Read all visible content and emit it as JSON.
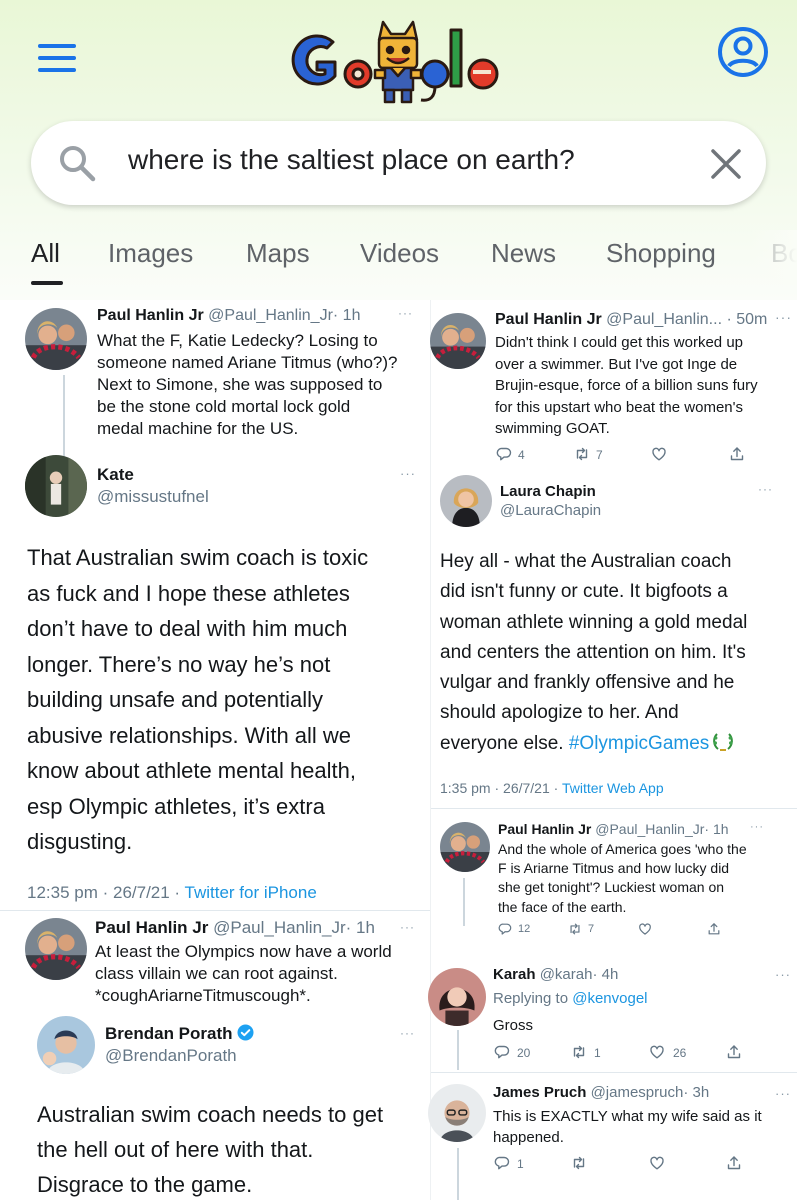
{
  "search": {
    "query": "where is the saltiest place on earth?"
  },
  "tabs": [
    {
      "label": "All"
    },
    {
      "label": "Images"
    },
    {
      "label": "Maps"
    },
    {
      "label": "Videos"
    },
    {
      "label": "News"
    },
    {
      "label": "Shopping"
    },
    {
      "label": "Bo"
    }
  ],
  "left": {
    "t1": {
      "name": "Paul Hanlin Jr",
      "handle": "@Paul_Hanlin_Jr",
      "time": "· 1h",
      "lines": [
        "What the F, Katie Ledecky?  Losing to",
        "someone named Ariane Titmus (who?)?",
        "Next to Simone, she was supposed to",
        "be the stone cold mortal lock gold",
        "medal machine for the US."
      ]
    },
    "t2": {
      "name": "Kate",
      "handle": "@missustufnel",
      "lines": [
        "That Australian swim coach is toxic",
        "as fuck and I hope these athletes",
        "don’t have to deal with him much",
        "longer. There’s no way he’s not",
        "building unsafe and potentially",
        "abusive relationships. With all we",
        "know about athlete mental health,",
        "esp Olympic athletes, it’s extra",
        "disgusting."
      ],
      "meta": "12:35 pm · 26/7/21 · ",
      "source": "Twitter for iPhone"
    },
    "t3": {
      "name": "Paul Hanlin Jr",
      "handle": "@Paul_Hanlin_Jr",
      "time": "· 1h",
      "lines": [
        "At least the Olympics now have a world",
        "class villain we can root against.",
        "*coughAriarneTitmuscough*."
      ]
    },
    "t4": {
      "name": "Brendan Porath",
      "handle": "@BrendanPorath",
      "lines": [
        "Australian swim coach needs to get",
        "the hell out of here with that.",
        "Disgrace to the game."
      ]
    }
  },
  "right": {
    "t1": {
      "name": "Paul Hanlin Jr",
      "handle": "@Paul_Hanlin...",
      "time": "· 50m",
      "lines": [
        "Didn't think I could get this worked up",
        "over a swimmer.  But I've got Inge de",
        "Brujin-esque, force of a billion suns fury",
        "for this upstart who beat the women's",
        "swimming GOAT."
      ],
      "replies": "4",
      "retweets": "7"
    },
    "t2": {
      "name": "Laura Chapin",
      "handle": "@LauraChapin",
      "lines": [
        "Hey all - what the Australian coach",
        "did isn't funny or cute. It bigfoots a",
        "woman athlete winning a gold medal",
        "and centers the attention on him. It's",
        "vulgar and frankly offensive and he",
        "should apologize to her. And"
      ],
      "last_line": "everyone else. ",
      "hashtag": "#OlympicGames",
      "meta": "1:35 pm · 26/7/21 · ",
      "source": "Twitter Web App"
    },
    "t3": {
      "name": "Paul Hanlin Jr",
      "handle": "@Paul_Hanlin_Jr",
      "time": "· 1h",
      "lines": [
        "And the whole of America goes 'who the",
        "F is Ariarne Titmus and how lucky did",
        "she get tonight'?  Luckiest woman on",
        "the face of the earth."
      ],
      "replies": "12",
      "retweets": "7"
    },
    "t4": {
      "name": "Karah",
      "handle": "@karah",
      "time": "· 4h",
      "replying_prefix": "Replying to ",
      "replying_to": "@kenvogel",
      "text": "Gross",
      "replies": "20",
      "retweets": "1",
      "likes": "26"
    },
    "t5": {
      "name": "James Pruch",
      "handle": "@jamespruch",
      "time": "· 3h",
      "lines": [
        "This is EXACTLY what my wife said as it",
        "happened."
      ],
      "replies": "1"
    }
  }
}
